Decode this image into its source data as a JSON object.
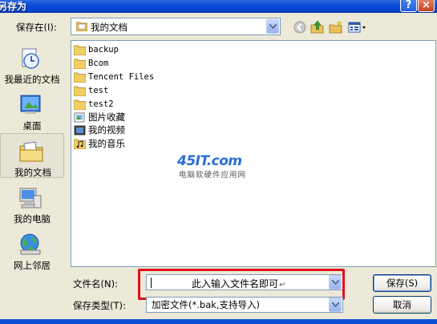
{
  "window": {
    "title": "另存为",
    "help_label": "?",
    "close_label": "×"
  },
  "save_in": {
    "label": "保存在(I):",
    "value": "我的文档"
  },
  "toolbar": {
    "icons": [
      "back-icon",
      "up-folder-icon",
      "new-folder-icon",
      "views-menu-icon"
    ]
  },
  "places": [
    {
      "label": "我最近的文档",
      "icon": "recent-documents-icon"
    },
    {
      "label": "桌面",
      "icon": "desktop-icon"
    },
    {
      "label": "我的文档",
      "icon": "my-documents-icon",
      "selected": true
    },
    {
      "label": "我的电脑",
      "icon": "my-computer-icon"
    },
    {
      "label": "网上邻居",
      "icon": "network-places-icon"
    }
  ],
  "files": [
    {
      "name": "backup",
      "icon": "folder-icon"
    },
    {
      "name": "Bcom",
      "icon": "folder-icon"
    },
    {
      "name": "Tencent Files",
      "icon": "folder-icon"
    },
    {
      "name": "test",
      "icon": "folder-icon"
    },
    {
      "name": "test2",
      "icon": "folder-icon"
    },
    {
      "name": "图片收藏",
      "icon": "pictures-folder-icon"
    },
    {
      "name": "我的视频",
      "icon": "videos-folder-icon"
    },
    {
      "name": "我的音乐",
      "icon": "music-folder-icon"
    }
  ],
  "watermark": {
    "logo": "45IT.com",
    "subtitle": "电脑软硬件应用网"
  },
  "file_name": {
    "label": "文件名(N):",
    "value": "此入输入文件名即可",
    "return_mark": "↵"
  },
  "file_type": {
    "label": "保存类型(T):",
    "value": "加密文件(*.bak,支持导入)"
  },
  "buttons": {
    "save": "保存(S)",
    "cancel": "取消"
  },
  "colors": {
    "titlebar": "#0a4bd6",
    "dialog_bg": "#ece9d8",
    "highlight": "#e0101a",
    "watermark_blue": "#2a6fcf"
  }
}
